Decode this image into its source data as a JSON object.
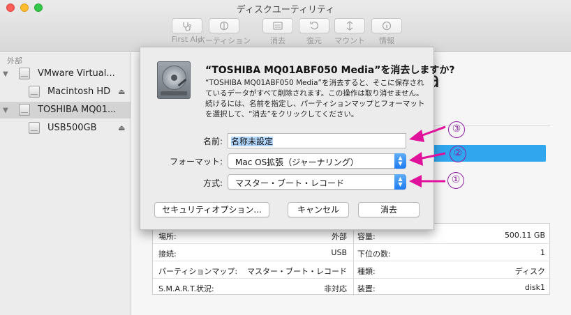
{
  "window": {
    "title": "ディスクユーティリティ"
  },
  "toolbar": {
    "items": [
      {
        "label": "First Aid",
        "icon": "stethoscope-icon"
      },
      {
        "label": "パーティション",
        "icon": "partition-icon"
      },
      {
        "label": "消去",
        "icon": "erase-icon"
      },
      {
        "label": "復元",
        "icon": "restore-icon"
      },
      {
        "label": "マウント",
        "icon": "mount-icon"
      },
      {
        "label": "情報",
        "icon": "info-icon"
      }
    ]
  },
  "sidebar": {
    "header": "外部",
    "items": [
      {
        "label": "VMware Virtual...",
        "level": 0,
        "expand": "▼",
        "selected": false,
        "eject": ""
      },
      {
        "label": "Macintosh HD",
        "level": 1,
        "expand": "",
        "selected": false,
        "eject": "⏏"
      },
      {
        "label": "TOSHIBA MQ01...",
        "level": 0,
        "expand": "▼",
        "selected": true,
        "eject": ""
      },
      {
        "label": "USB500GB",
        "level": 1,
        "expand": "",
        "selected": false,
        "eject": "⏏"
      }
    ]
  },
  "background": {
    "partial_title_char": "a"
  },
  "info_table": {
    "rows": [
      {
        "left_label": "場所:",
        "left_value": "外部",
        "right_label": "容量:",
        "right_value": "500.11 GB"
      },
      {
        "left_label": "接続:",
        "left_value": "USB",
        "right_label": "下位の数:",
        "right_value": "1"
      },
      {
        "left_label": "パーティションマップ:",
        "left_value": "マスター・ブート・レコード",
        "right_label": "種類:",
        "right_value": "ディスク"
      },
      {
        "left_label": "S.M.A.R.T.状況:",
        "left_value": "非対応",
        "right_label": "装置:",
        "right_value": "disk1"
      }
    ]
  },
  "sheet": {
    "title": "“TOSHIBA MQ01ABF050 Media”を消去しますか?",
    "description_lines": [
      "“TOSHIBA MQ01ABF050 Media”を消去すると、そこに保存され",
      "ているデータがすべて削除されます。この操作は取り消せません。",
      "続けるには、名前を指定し、パーティションマップとフォーマット",
      "を選択して、“消去”をクリックしてください。"
    ],
    "name_label": "名前:",
    "name_value": "名称未設定",
    "format_label": "フォーマット:",
    "format_value": "Mac OS拡張（ジャーナリング）",
    "scheme_label": "方式:",
    "scheme_value": "マスター・ブート・レコード",
    "security_button": "セキュリティオプション...",
    "cancel_button": "キャンセル",
    "erase_button": "消去"
  },
  "annotations": {
    "color": "#e0119b",
    "numbers": [
      "③",
      "②",
      "①"
    ]
  }
}
